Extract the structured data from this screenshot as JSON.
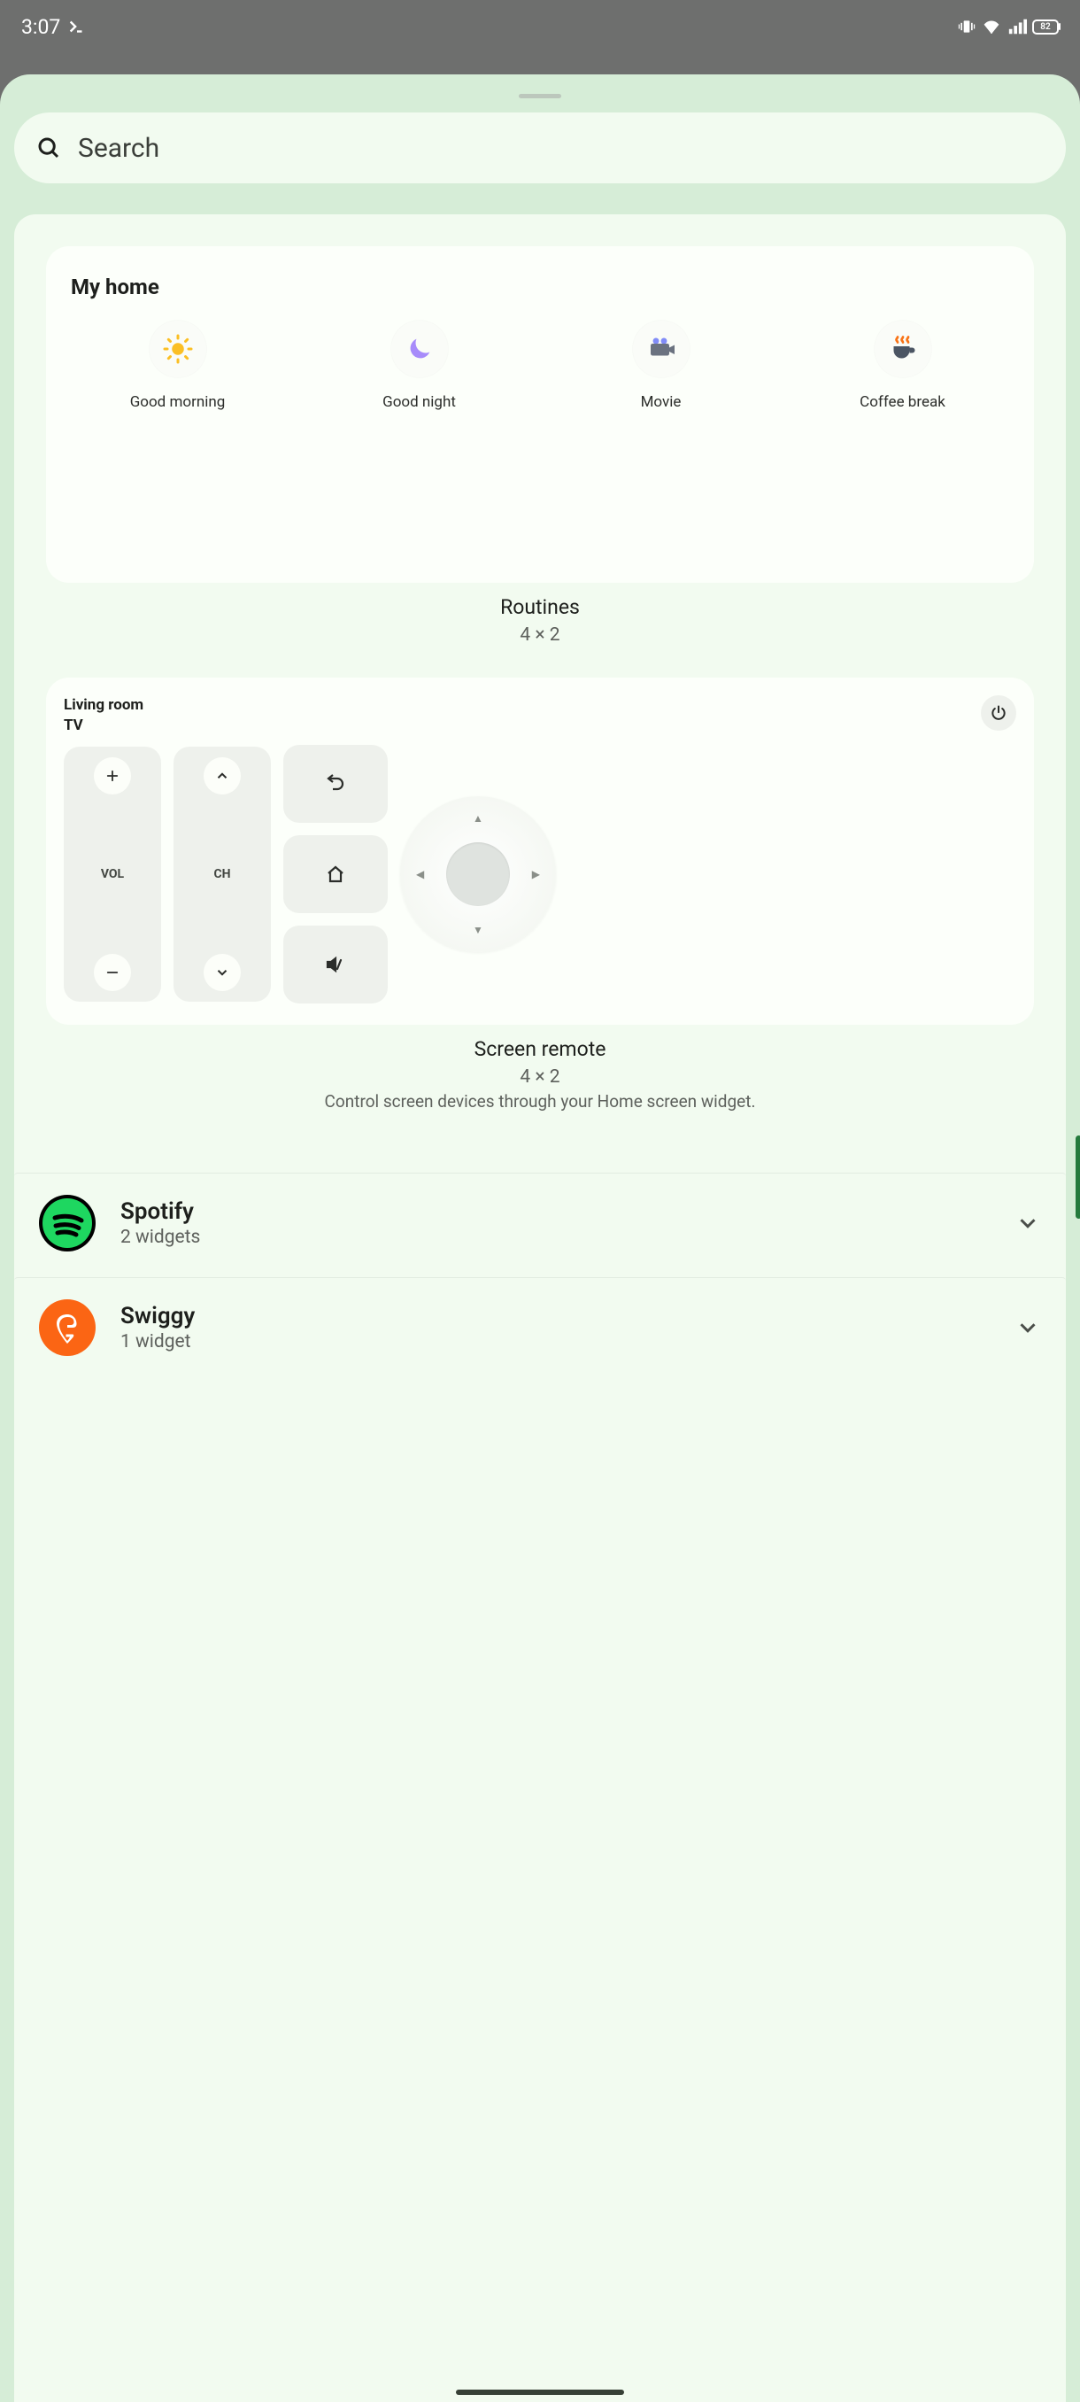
{
  "status": {
    "time": "3:07",
    "battery": "82"
  },
  "search": {
    "placeholder": "Search"
  },
  "widgets": {
    "home_card": {
      "title": "My home",
      "routines": [
        {
          "icon": "sun",
          "label": "Good morning"
        },
        {
          "icon": "moon",
          "label": "Good night"
        },
        {
          "icon": "movie",
          "label": "Movie"
        },
        {
          "icon": "coffee",
          "label": "Coffee break"
        }
      ],
      "meta_title": "Routines",
      "meta_size": "4 × 2"
    },
    "remote_card": {
      "room": "Living room",
      "device": "TV",
      "vol_label": "VOL",
      "ch_label": "CH",
      "meta_title": "Screen remote",
      "meta_size": "4 × 2",
      "meta_desc": "Control screen devices through your Home screen widget."
    }
  },
  "apps": [
    {
      "name": "Spotify",
      "widgets": "2 widgets"
    },
    {
      "name": "Swiggy",
      "widgets": "1 widget"
    }
  ]
}
